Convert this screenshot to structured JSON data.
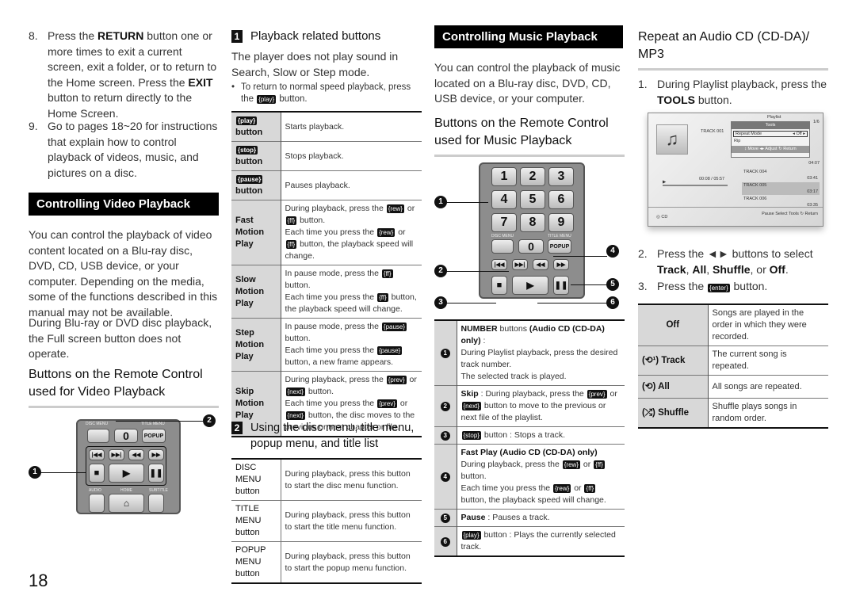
{
  "page_number": "18",
  "col1": {
    "steps": [
      {
        "num": "8.",
        "text": "Press the **RETURN** button one or more times to exit a current screen, exit a folder, or to return to the Home screen. Press the **EXIT** button to return directly to the Home Screen."
      },
      {
        "num": "9.",
        "text": "Go to pages 18~20 for instructions that explain how to control playback of videos, music, and pictures on a disc."
      }
    ],
    "video_header": "Controlling Video Playback",
    "para1": "You can control the playback of video content located on a Blu-ray disc, DVD, CD, USB device, or your computer. Depending on the media, some of the functions described in this manual may not be available.",
    "para2": "During Blu-ray or DVD disc playback, the Full screen button does not operate.",
    "remote_heading": "Buttons on the Remote Control used for Video Playback",
    "remote": {
      "disc_menu": "DISC MENU",
      "title_menu": "TITLE MENU",
      "zero": "0",
      "popup": "POPUP",
      "audio": "AUDIO",
      "home": "HOME",
      "subtitle": "SUBTITLE",
      "callouts": [
        "1",
        "2"
      ]
    }
  },
  "col2": {
    "sec1": {
      "num": "1",
      "title": "Playback related buttons"
    },
    "note": "The player does not play sound in Search, Slow or Step mode.",
    "bullet": "To return to normal speed playback, press the {play} button.",
    "table1": [
      {
        "label": "{play} button",
        "desc": "Starts playback."
      },
      {
        "label": "{stop} button",
        "desc": "Stops playback."
      },
      {
        "label": "{pause} button",
        "desc": "Pauses playback."
      },
      {
        "label": "Fast Motion Play",
        "desc": "During playback, press the {rew} or {ff} button.\nEach time you press the {rew} or {ff} button, the playback speed will change."
      },
      {
        "label": "Slow Motion Play",
        "desc": "In pause mode, press the {ff} button.\nEach time you press the {ff} button, the playback speed will change."
      },
      {
        "label": "Step Motion Play",
        "desc": "In pause mode, press the {pause} button.\nEach time you press the {pause} button, a new frame appears."
      },
      {
        "label": "Skip Motion Play",
        "desc": "During playback, press the {prev} or {next} button.\nEach time you press the {prev} or {next} button, the disc moves to the previous or next chapter or file."
      }
    ],
    "sec2": {
      "num": "2",
      "title": "Using the disc menu, title menu, popup menu, and title list"
    },
    "table2": [
      {
        "label": "DISC MENU button",
        "desc": "During playback, press this button to start the disc menu function."
      },
      {
        "label": "TITLE MENU button",
        "desc": "During playback, press this button to start the title menu function."
      },
      {
        "label": "POPUP MENU button",
        "desc": "During playback, press this button to start the popup menu function."
      }
    ]
  },
  "col3": {
    "music_header": "Controlling Music Playback",
    "para": "You can control the playback of music located on a Blu-ray disc, DVD, CD, USB device, or your computer.",
    "remote_heading": "Buttons on the Remote Control used for Music Playback",
    "remote": {
      "keys": [
        "1",
        "2",
        "3",
        "4",
        "5",
        "6",
        "7",
        "8",
        "9"
      ],
      "zero": "0",
      "popup": "POPUP",
      "disc_menu": "DISC MENU",
      "title_menu": "TITLE MENU",
      "callouts": [
        "1",
        "2",
        "3",
        "4",
        "5",
        "6"
      ]
    },
    "table": [
      {
        "n": "1",
        "desc": "**NUMBER** buttons **(Audio CD (CD-DA) only)** :\nDuring Playlist playback, press the desired track number.\nThe selected track is played."
      },
      {
        "n": "2",
        "desc": "**Skip** : During playback, press the {prev} or {next} button to move to the previous or next file of the playlist."
      },
      {
        "n": "3",
        "desc": "{stop} button : Stops a track."
      },
      {
        "n": "4",
        "desc": "**Fast Play (Audio CD (CD-DA) only)**\nDuring playback, press the {rew} or {ff} button.\nEach time you press the {rew} or {ff} button, the playback speed will change."
      },
      {
        "n": "5",
        "desc": "**Pause** : Pauses a track."
      },
      {
        "n": "6",
        "desc": "{play} button : Plays the currently selected track."
      }
    ]
  },
  "col4": {
    "heading": "Repeat an Audio CD (CD-DA)/ MP3",
    "step1": {
      "num": "1.",
      "text": "During Playlist playback, press the **TOOLS** button."
    },
    "screen": {
      "playlist": "Playlist",
      "page": "1/6",
      "track_current": "TRACK 001",
      "time": "00:08 / 05:57",
      "tools_title": "Tools",
      "repeat_mode": "Repeat Mode",
      "repeat_value": "Off",
      "rip": "Rip",
      "hint": "↕ Move  ◂▸ Adjust  ↻ Return",
      "tracks": [
        {
          "name": "TRACK 004",
          "dur": "03:41"
        },
        {
          "name": "TRACK 005",
          "dur": "03:17"
        },
        {
          "name": "TRACK 006",
          "dur": "03:35"
        }
      ],
      "hidden_dur": "04:07",
      "source": "CD",
      "footer": "Pause  Select  Tools  ↻ Return"
    },
    "step2": {
      "num": "2.",
      "text": "Press the ◄► buttons to select **Track**, **All**, **Shuffle**, or **Off**."
    },
    "step3": {
      "num": "3.",
      "text": "Press the {enter} button."
    },
    "table": [
      {
        "icon": "",
        "label": "Off",
        "desc": "Songs are played in the order in which they were recorded."
      },
      {
        "icon": "repeat-one-icon",
        "label": "Track",
        "desc": "The current song is repeated."
      },
      {
        "icon": "repeat-all-icon",
        "label": "All",
        "desc": "All songs are repeated."
      },
      {
        "icon": "shuffle-icon",
        "label": "Shuffle",
        "desc": "Shuffle plays songs in random order."
      }
    ]
  }
}
